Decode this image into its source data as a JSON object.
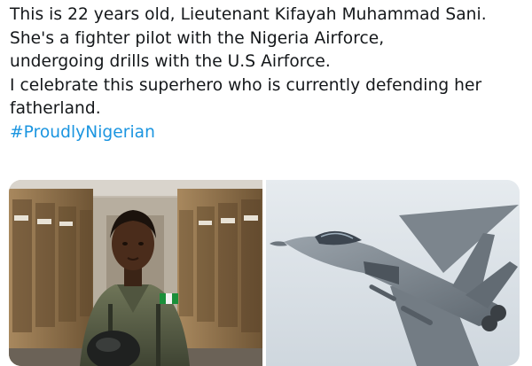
{
  "tweet": {
    "lines": [
      "This is 22 years old, Lieutenant Kifayah Muhammad Sani.",
      "She's a fighter pilot with the Nigeria Airforce,",
      "undergoing drills with the U.S Airforce.",
      "I celebrate this superhero who is currently defending her",
      "fatherland."
    ],
    "hashtag": "#ProudlyNigerian"
  },
  "media": {
    "photos": [
      {
        "subject": "pilot-in-locker-room"
      },
      {
        "subject": "fighter-jet-in-flight"
      }
    ]
  }
}
